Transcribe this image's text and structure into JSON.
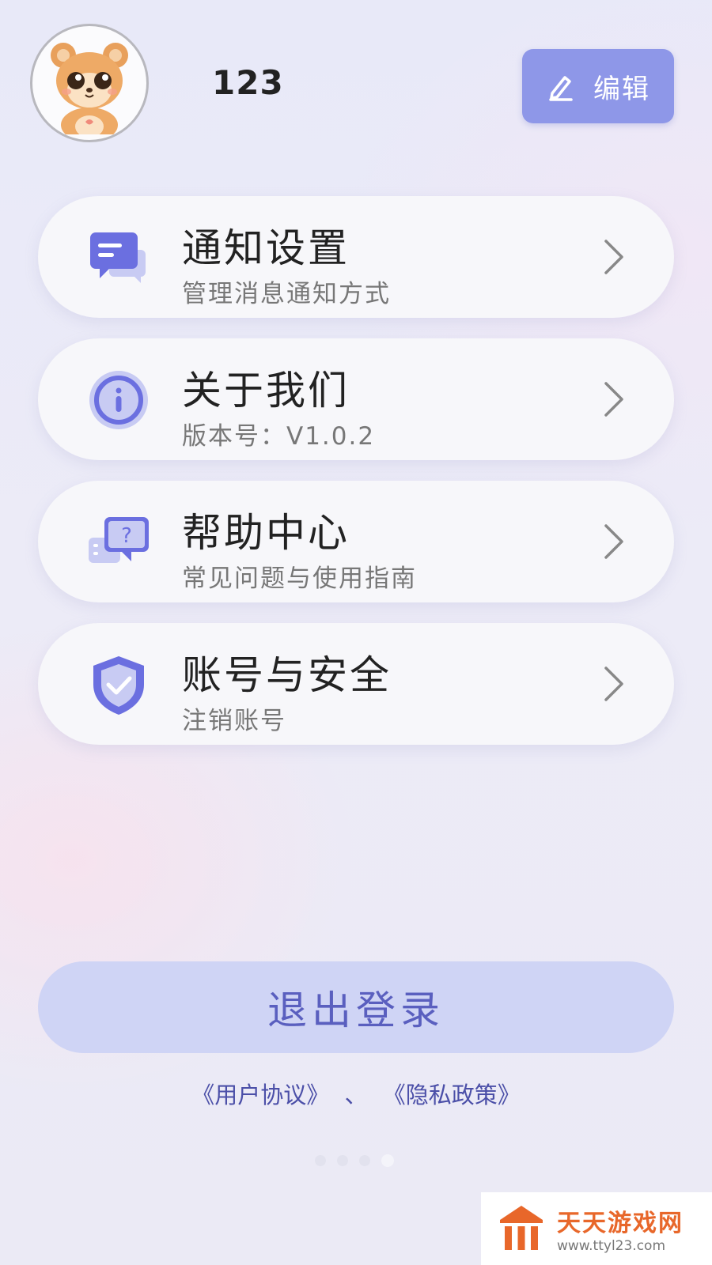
{
  "profile": {
    "username": "123",
    "edit_label": "编辑"
  },
  "menu": [
    {
      "title": "通知设置",
      "subtitle": "管理消息通知方式",
      "icon": "message-icon"
    },
    {
      "title": "关于我们",
      "subtitle": "版本号：V1.0.2",
      "icon": "info-icon"
    },
    {
      "title": "帮助中心",
      "subtitle": "常见问题与使用指南",
      "icon": "help-icon"
    },
    {
      "title": "账号与安全",
      "subtitle": "注销账号",
      "icon": "shield-icon"
    }
  ],
  "logout_label": "退出登录",
  "legal": {
    "user_agreement": "《用户协议》",
    "separator": "、",
    "privacy_policy": "《隐私政策》"
  },
  "watermark": {
    "title": "天天游戏网",
    "url": "www.ttyl23.com"
  },
  "colors": {
    "accent": "#8e97e8",
    "logout_bg": "#cfd4f5",
    "logout_text": "#5a5fbf",
    "icon_purple": "#6b6fe0"
  }
}
